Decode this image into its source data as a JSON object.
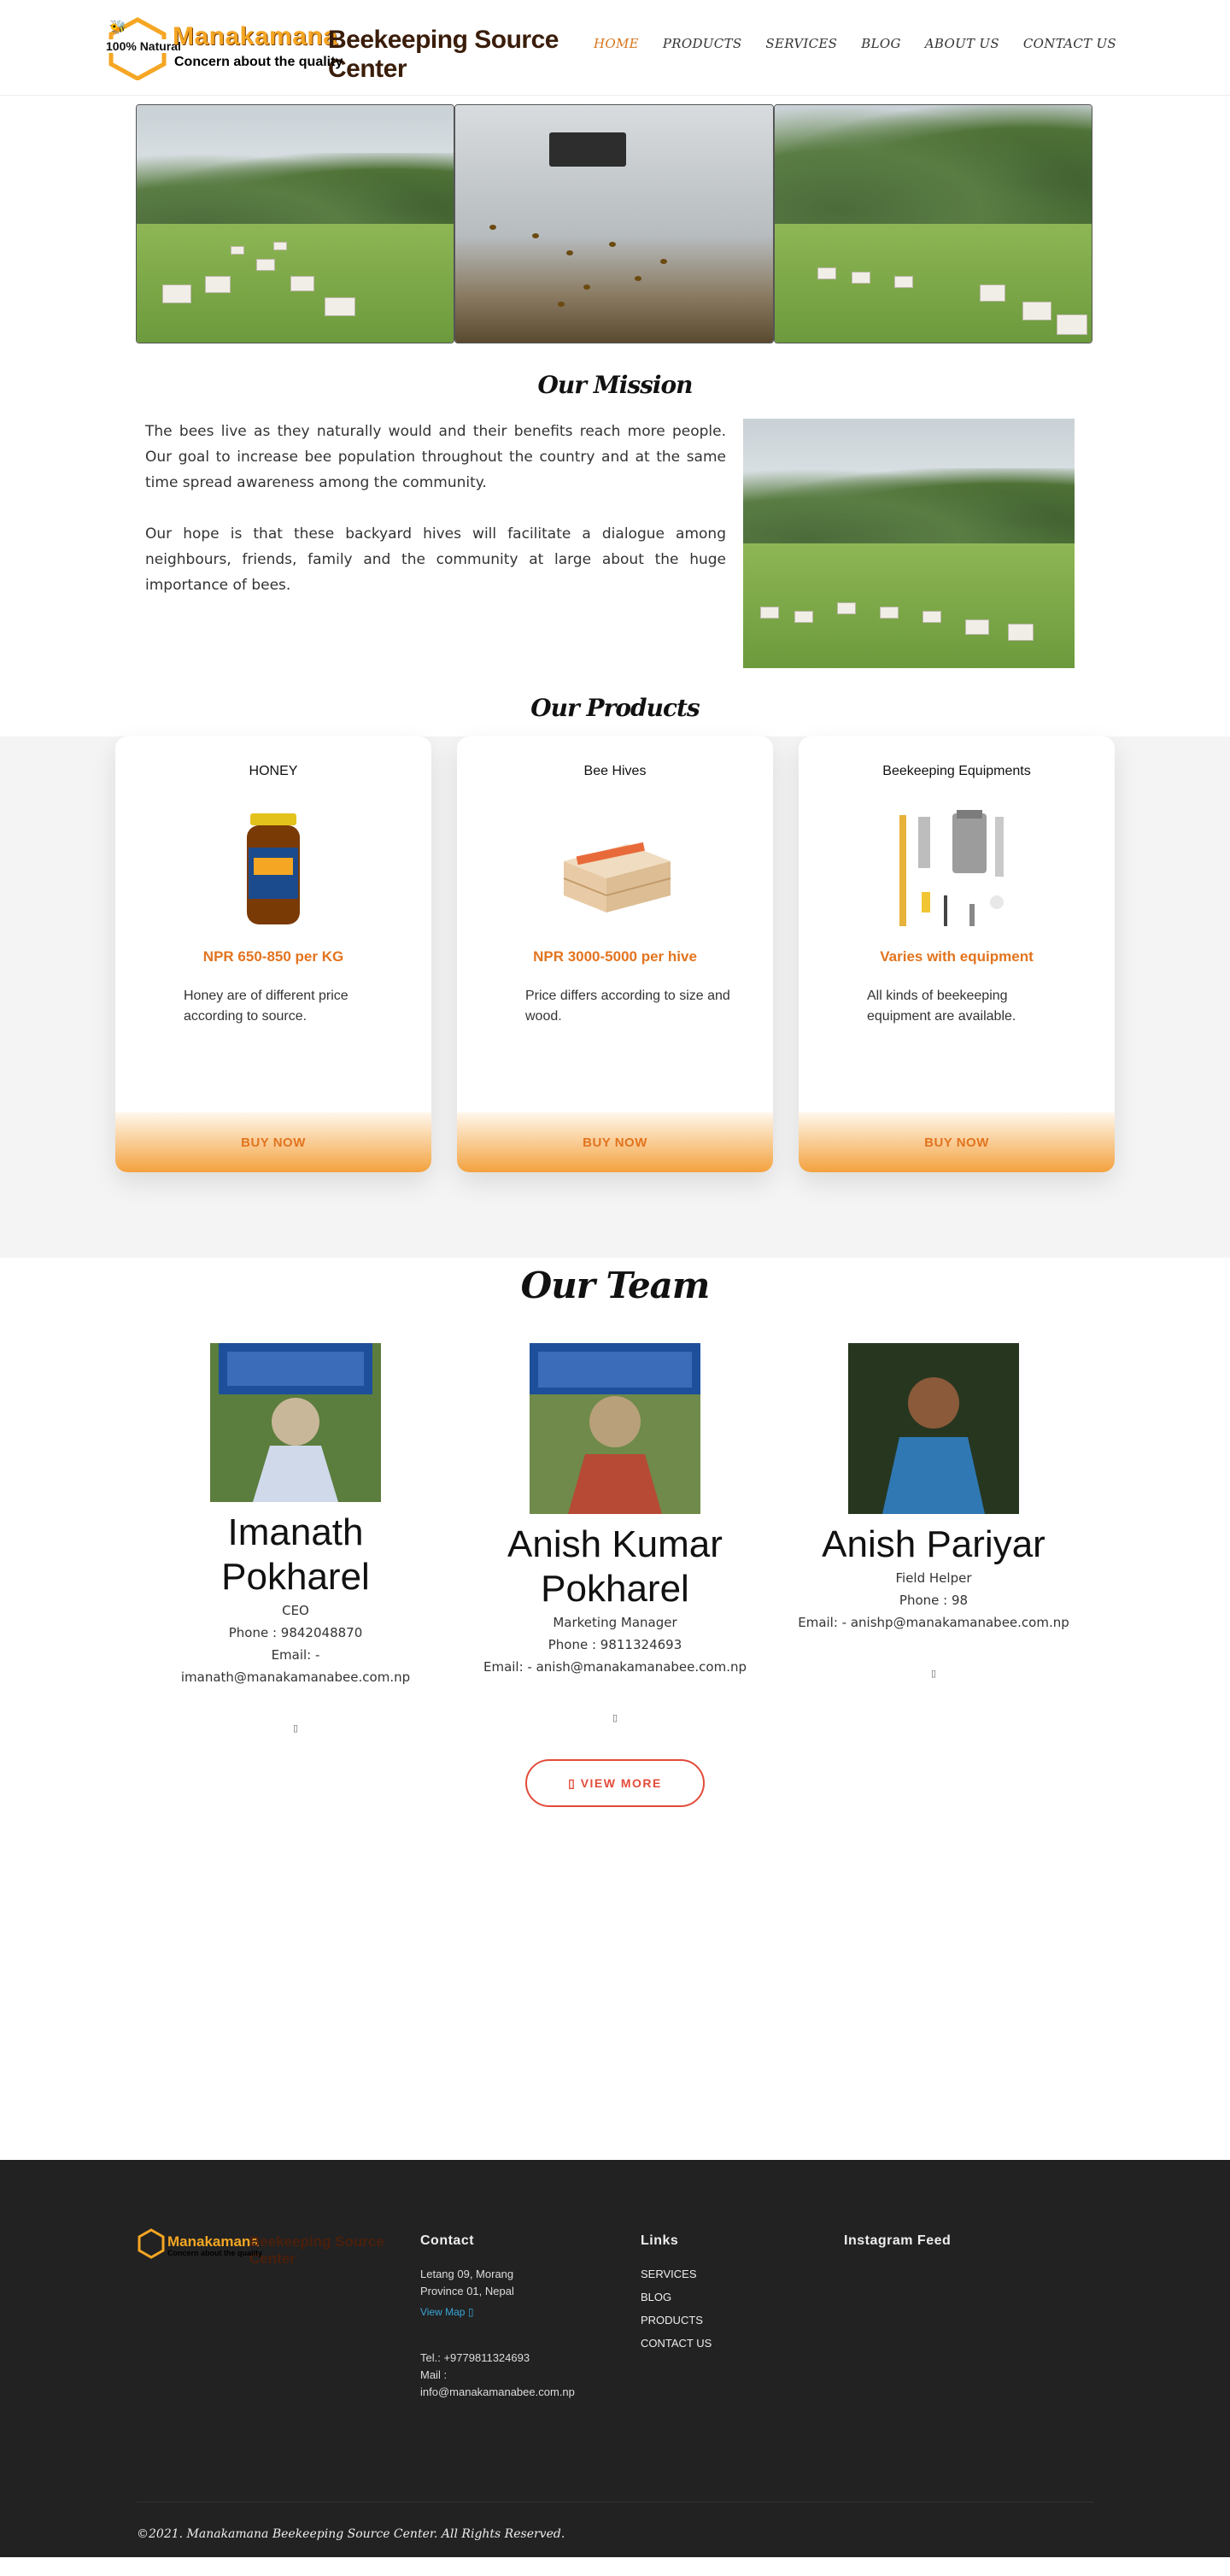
{
  "header": {
    "logo_badge": "100% Natural",
    "logo_title_1": "Manakamana",
    "logo_title_2": "Beekeeping Source Center",
    "logo_tagline": "Concern about the quality",
    "nav": [
      "HOME",
      "PRODUCTS",
      "SERVICES",
      "BLOG",
      "ABOUT US",
      "CONTACT US"
    ]
  },
  "mission": {
    "title": "Our Mission",
    "p1": "The bees live as they naturally would and their benefits reach more people. Our goal to increase bee population throughout the country and at the same time spread awareness among the community.",
    "p2": "Our hope is that these backyard hives will facilitate a dialogue among neighbours, friends, family and the community at large about the huge importance of bees."
  },
  "products": {
    "title": "Our Products",
    "items": [
      {
        "name": "HONEY",
        "price": "NPR 650-850 per KG",
        "desc": "Honey are of different price according to source.",
        "button": "BUY NOW"
      },
      {
        "name": "Bee Hives",
        "price": "NPR 3000-5000 per hive",
        "desc": "Price differs according to size and wood.",
        "button": "BUY NOW"
      },
      {
        "name": "Beekeeping Equipments",
        "price": "Varies with equipment",
        "desc": "All kinds of beekeeping equipment are available.",
        "button": "BUY NOW"
      }
    ]
  },
  "team": {
    "title": "Our Team",
    "members": [
      {
        "name": "Imanath Pokharel",
        "role": "CEO",
        "phone": "Phone : 9842048870",
        "email": "Email: - imanath@manakamanabee.com.np"
      },
      {
        "name": "Anish Kumar Pokharel",
        "role": "Marketing Manager",
        "phone": "Phone : 9811324693",
        "email": "Email: - anish@manakamanabee.com.np"
      },
      {
        "name": "Anish Pariyar",
        "role": "Field Helper",
        "phone": "Phone : 98",
        "email": "Email: - anishp@manakamanabee.com.np"
      }
    ],
    "view_more": "VIEW MORE"
  },
  "footer": {
    "contact_head": "Contact",
    "address": "Letang 09, Morang Province 01, Nepal",
    "view_map": "View Map",
    "tel": "Tel.: +9779811324693",
    "mail_label": "Mail :",
    "mail": "info@manakamanabee.com.np",
    "links_head": "Links",
    "links": [
      "SERVICES",
      "BLOG",
      "PRODUCTS",
      "CONTACT US"
    ],
    "instagram_head": "Instagram Feed",
    "copyright": "©2021. Manakamana Beekeeping Source Center. All Rights Reserved."
  },
  "colors": {
    "accent": "#e2741f",
    "honey": "#f5a623",
    "button_border": "#e34b3a",
    "footer_bg": "#222222"
  }
}
